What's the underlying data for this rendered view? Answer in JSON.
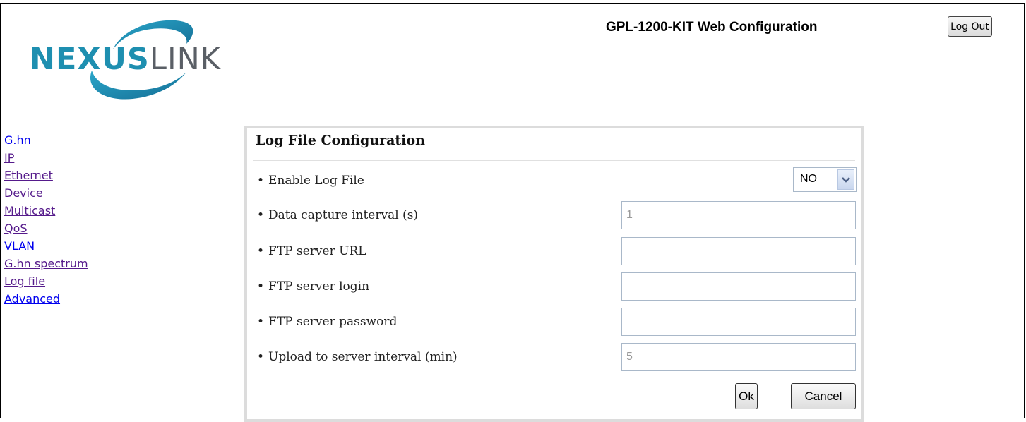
{
  "header": {
    "logo_text": "NEXUSLINK",
    "title": "GPL-1200-KIT Web Configuration",
    "logout_label": "Log Out"
  },
  "nav": {
    "items": [
      {
        "label": "G.hn",
        "visited": false
      },
      {
        "label": "IP",
        "visited": true
      },
      {
        "label": "Ethernet",
        "visited": true
      },
      {
        "label": "Device",
        "visited": true
      },
      {
        "label": "Multicast",
        "visited": true
      },
      {
        "label": "QoS",
        "visited": true
      },
      {
        "label": "VLAN",
        "visited": false
      },
      {
        "label": "G.hn spectrum",
        "visited": true
      },
      {
        "label": "Log file",
        "visited": true
      },
      {
        "label": "Advanced",
        "visited": false
      }
    ]
  },
  "form": {
    "title": "Log File Configuration",
    "enable_label": "Enable Log File",
    "enable_value": "NO",
    "capture_label": "Data capture interval (s)",
    "capture_value": "1",
    "ftp_url_label": "FTP server URL",
    "ftp_url_value": "",
    "ftp_login_label": "FTP server login",
    "ftp_login_value": "",
    "ftp_password_label": "FTP server password",
    "ftp_password_value": "",
    "upload_label": "Upload to server interval (min)",
    "upload_value": "5",
    "ok_label": "Ok",
    "cancel_label": "Cancel"
  },
  "colors": {
    "link_unvisited": "#0000ee",
    "link_visited": "#551a8b",
    "logo_gray": "#5a5f66",
    "logo_teal": "#1e8fb0"
  }
}
